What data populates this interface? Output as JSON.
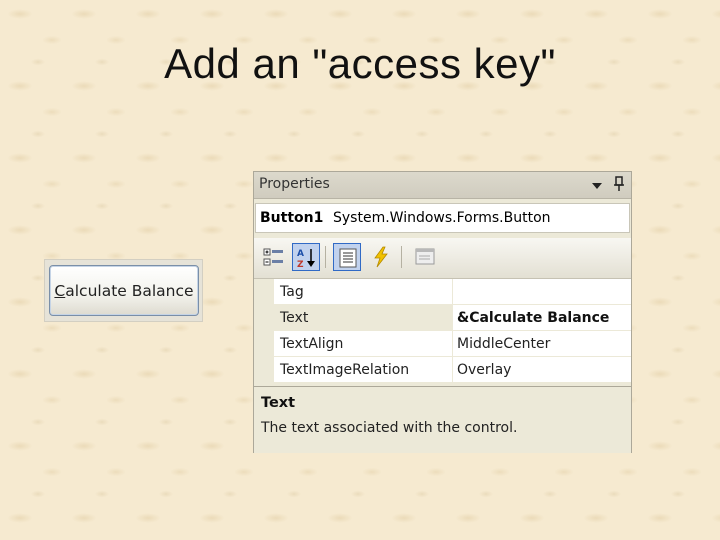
{
  "slide": {
    "title": "Add an \"access key\""
  },
  "sample_button": {
    "label_mnemonic": "C",
    "label_rest": "alculate Balance"
  },
  "properties": {
    "title": "Properties",
    "object": {
      "name": "Button1",
      "type": "System.Windows.Forms.Button"
    },
    "toolbar": [
      {
        "icon": "categorized-icon",
        "active": false
      },
      {
        "icon": "alphabetical-sort-icon",
        "active": true
      },
      {
        "icon": "properties-list-icon",
        "active": true
      },
      {
        "icon": "events-lightning-icon",
        "active": false
      },
      {
        "icon": "property-pages-icon",
        "active": false
      }
    ],
    "rows": [
      {
        "name": "Tag",
        "value": ""
      },
      {
        "name": "Text",
        "value": "&Calculate Balance",
        "selected": true
      },
      {
        "name": "TextAlign",
        "value": "MiddleCenter"
      },
      {
        "name": "TextImageRelation",
        "value": "Overlay"
      }
    ],
    "description": {
      "title": "Text",
      "body": "The text associated with the control."
    }
  },
  "colors": {
    "background": "#f6ead0",
    "panel": "#ece9d8",
    "active_button": "#c1d2ee",
    "active_border": "#316ac5"
  }
}
